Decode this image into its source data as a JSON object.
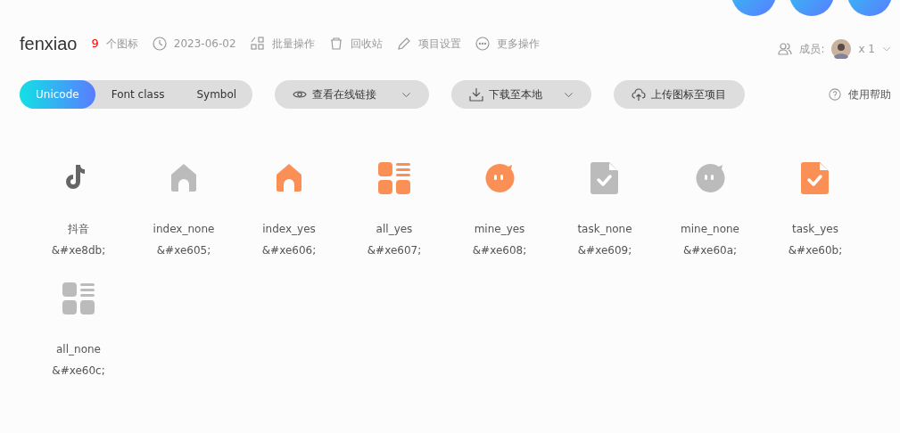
{
  "project": {
    "name": "fenxiao",
    "icon_count": "9",
    "icon_count_label": "个图标",
    "date": "2023-06-02"
  },
  "actions": [
    {
      "kind": "batch",
      "label": "批量操作"
    },
    {
      "kind": "trash",
      "label": "回收站"
    },
    {
      "kind": "edit",
      "label": "项目设置"
    },
    {
      "kind": "more",
      "label": "更多操作"
    }
  ],
  "members": {
    "label": "成员:",
    "count": "x 1"
  },
  "mode_tabs": [
    {
      "label": "Unicode",
      "selected": true
    },
    {
      "label": "Font class",
      "selected": false
    },
    {
      "label": "Symbol",
      "selected": false
    }
  ],
  "toolbar_buttons": [
    {
      "kind": "view",
      "label": "查看在线链接",
      "dropdown": true
    },
    {
      "kind": "download",
      "label": "下载至本地",
      "dropdown": true
    },
    {
      "kind": "upload",
      "label": "上传图标至项目",
      "dropdown": false
    }
  ],
  "help": {
    "label": "使用帮助"
  },
  "icons": [
    {
      "kind": "tiktok",
      "color": "#666666",
      "name": "抖音",
      "code": "&#xe8db;"
    },
    {
      "kind": "home",
      "color": "#bbbbbb",
      "name": "index_none",
      "code": "&#xe605;"
    },
    {
      "kind": "home",
      "color": "#fb9056",
      "name": "index_yes",
      "code": "&#xe606;"
    },
    {
      "kind": "grid",
      "color": "#fb9056",
      "name": "all_yes",
      "code": "&#xe607;"
    },
    {
      "kind": "chat",
      "color": "#fb9056",
      "name": "mine_yes",
      "code": "&#xe608;"
    },
    {
      "kind": "task",
      "color": "#bbbbbb",
      "name": "task_none",
      "code": "&#xe609;"
    },
    {
      "kind": "chat",
      "color": "#bbbbbb",
      "name": "mine_none",
      "code": "&#xe60a;"
    },
    {
      "kind": "task",
      "color": "#fb9056",
      "name": "task_yes",
      "code": "&#xe60b;"
    },
    {
      "kind": "grid",
      "color": "#bbbbbb",
      "name": "all_none",
      "code": "&#xe60c;"
    }
  ]
}
